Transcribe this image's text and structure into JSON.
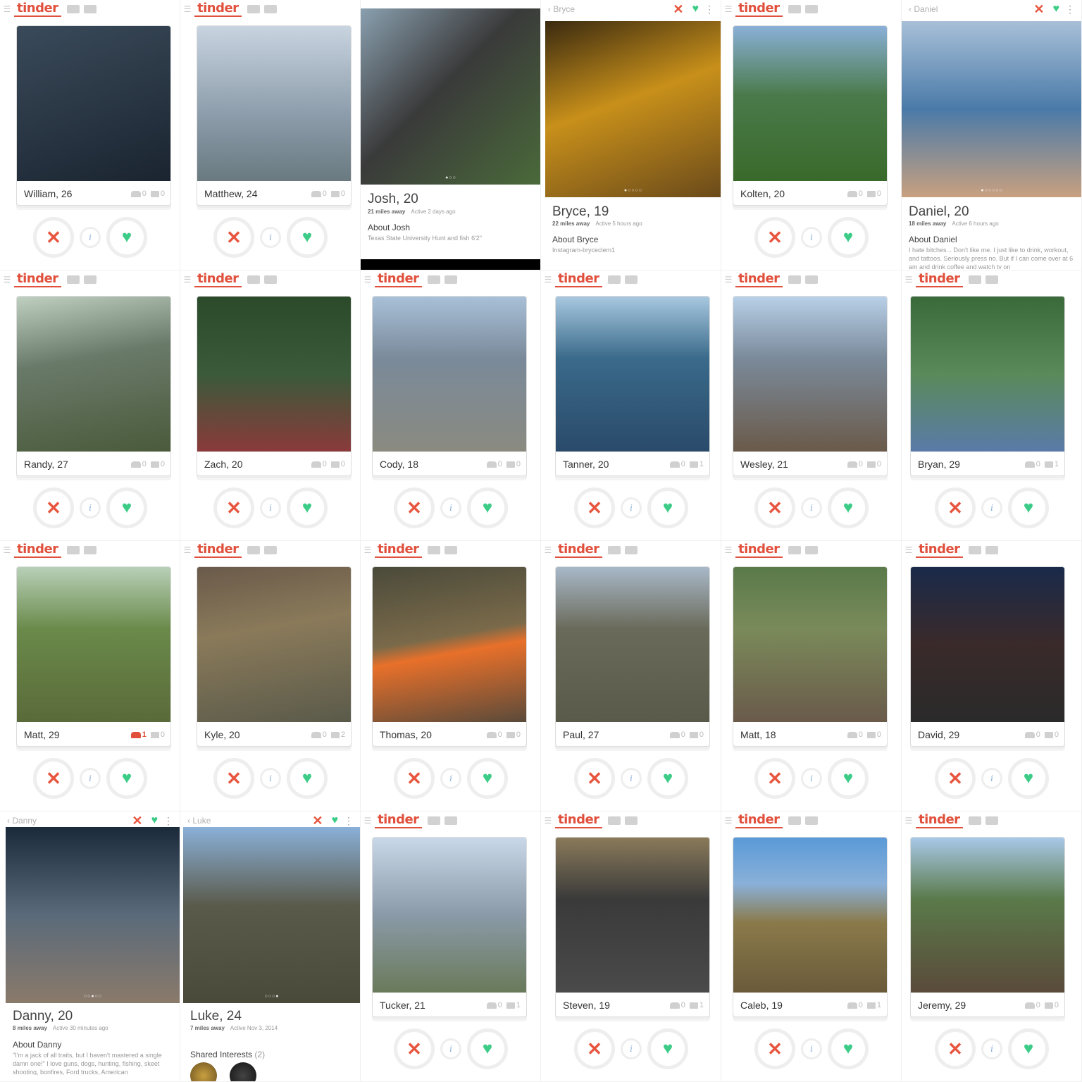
{
  "brand": {
    "logo": "tinder",
    "accent": "#e0503c",
    "like": "#3ccc87",
    "nope": "#e8553e"
  },
  "profiles": [
    {
      "name": "William, 26",
      "friends": "0",
      "interests": "0"
    },
    {
      "name": "Matthew, 24",
      "friends": "0",
      "interests": "0"
    },
    {
      "name": "Kolten, 20",
      "friends": "0",
      "interests": "0"
    },
    {
      "name": "Randy, 27",
      "friends": "0",
      "interests": "0"
    },
    {
      "name": "Zach, 20",
      "friends": "0",
      "interests": "0"
    },
    {
      "name": "Cody, 18",
      "friends": "0",
      "interests": "0"
    },
    {
      "name": "Tanner, 20",
      "friends": "0",
      "interests": "1"
    },
    {
      "name": "Wesley, 21",
      "friends": "0",
      "interests": "0"
    },
    {
      "name": "Bryan, 29",
      "friends": "0",
      "interests": "1"
    },
    {
      "name": "Matt, 29",
      "friends": "1",
      "interests": "0"
    },
    {
      "name": "Kyle, 20",
      "friends": "0",
      "interests": "2"
    },
    {
      "name": "Thomas, 20",
      "friends": "0",
      "interests": "0"
    },
    {
      "name": "Paul, 27",
      "friends": "0",
      "interests": "0"
    },
    {
      "name": "Matt, 18",
      "friends": "0",
      "interests": "0"
    },
    {
      "name": "David, 29",
      "friends": "0",
      "interests": "0"
    },
    {
      "name": "Tucker, 21",
      "friends": "0",
      "interests": "1"
    },
    {
      "name": "Steven, 19",
      "friends": "0",
      "interests": "1"
    },
    {
      "name": "Caleb, 19",
      "friends": "0",
      "interests": "1"
    },
    {
      "name": "Jeremy, 29",
      "friends": "0",
      "interests": "0"
    }
  ],
  "details": {
    "josh": {
      "name": "Josh, 20",
      "distance": "21 miles away",
      "active": "Active 2 days ago",
      "about_title": "About Josh",
      "bio": "Texas State University Hunt and fish 6'2\""
    },
    "bryce": {
      "back": "Bryce",
      "name": "Bryce, 19",
      "distance": "22 miles away",
      "active": "Active 5 hours ago",
      "about_title": "About Bryce",
      "bio": "Instagram-bryceclem1"
    },
    "daniel": {
      "back": "Daniel",
      "name": "Daniel, 20",
      "distance": "18 miles away",
      "active": "Active 6 hours ago",
      "about_title": "About Daniel",
      "bio": "I hate bitches... Don't like me. I just like to drink, workout, and tattoos. Seriously press no. But if I can come over at 6 am and drink coffee and watch tv on"
    },
    "danny": {
      "back": "Danny",
      "name": "Danny, 20",
      "distance": "8 miles away",
      "active": "Active 30 minutes ago",
      "about_title": "About Danny",
      "bio": "\"I'm a jack of all traits, but I haven't mastered a single damn one!\" I love guns, dogs, hunting, fishing, skeet shooting, bonfires, Ford trucks, American"
    },
    "luke": {
      "back": "Luke",
      "name": "Luke, 24",
      "distance": "7 miles away",
      "active": "Active Nov 3, 2014",
      "shared_title": "Shared Interests",
      "shared_count": "(2)"
    }
  },
  "photo_colors": [
    "#2a3a4a",
    "#8aa0b8",
    "#6d8a5a",
    "#5a6e4a",
    "#2d4a2d",
    "#9aa0a8",
    "#3a5a6a",
    "#7a8a9a",
    "#4a6a8a",
    "#5a7a3a",
    "#6a5a4a",
    "#4a4a3a",
    "#7a6a5a",
    "#5a7a4a",
    "#3a2a2a",
    "#5a6a4a",
    "#4a4a4a",
    "#6a5a3a",
    "#5a7a8a"
  ]
}
